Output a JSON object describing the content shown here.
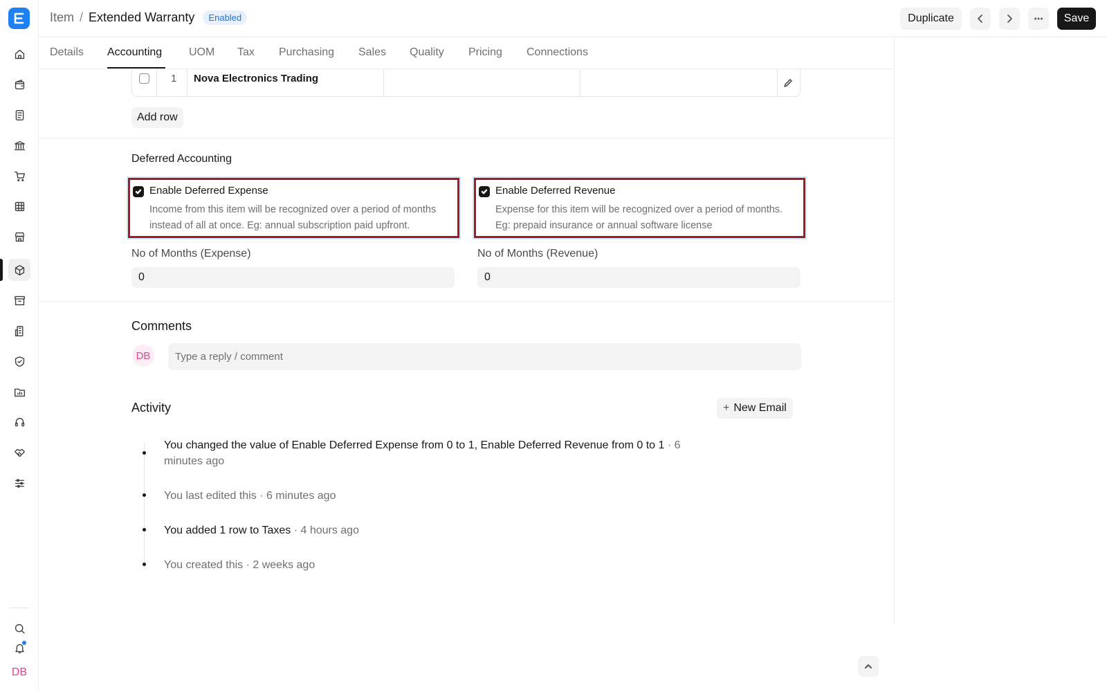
{
  "header": {
    "parent": "Item",
    "separator": "/",
    "title": "Extended Warranty",
    "status_badge": "Enabled",
    "duplicate_label": "Duplicate",
    "save_label": "Save"
  },
  "tabs": [
    "Details",
    "Accounting",
    "UOM",
    "Tax",
    "Purchasing",
    "Sales",
    "Quality",
    "Pricing",
    "Connections"
  ],
  "active_tab": "Accounting",
  "table": {
    "row": {
      "index": "1",
      "name": "Nova Electronics Trading"
    },
    "add_row_label": "Add row"
  },
  "deferred": {
    "section_title": "Deferred Accounting",
    "expense": {
      "label": "Enable Deferred Expense",
      "checked": true,
      "desc_line1": "Income from this item will be recognized over a period of months",
      "desc_line2": "instead of all at once. Eg: annual subscription paid upfront."
    },
    "revenue": {
      "label": "Enable Deferred Revenue",
      "checked": true,
      "desc_line1": "Expense for this item will be recognized over a period of months.",
      "desc_line2": "Eg: prepaid insurance or annual software license"
    },
    "months_expense": {
      "label": "No of Months (Expense)",
      "value": "0"
    },
    "months_revenue": {
      "label": "No of Months (Revenue)",
      "value": "0"
    }
  },
  "comments": {
    "title": "Comments",
    "avatar_initials": "DB",
    "placeholder": "Type a reply / comment"
  },
  "activity": {
    "title": "Activity",
    "new_email_label": "New Email",
    "items": [
      {
        "text_line1": "You changed the value of Enable Deferred Expense from 0 to 1, Enable Deferred Revenue from 0 to 1",
        "time_line1": " · 6",
        "time_line2": "minutes ago"
      },
      {
        "text": "You last edited this",
        "time": " · 6 minutes ago"
      },
      {
        "text": "You added 1 row to Taxes",
        "time": " · 4 hours ago"
      },
      {
        "text": "You created this",
        "time": " · 2 weeks ago"
      }
    ]
  },
  "sidebar": {
    "icons": [
      "home-icon",
      "wallet-icon",
      "document-icon",
      "bank-icon",
      "cart-icon",
      "table-icon",
      "store-icon",
      "box-icon",
      "archive-icon",
      "building-icon",
      "shield-icon",
      "folder-chart-icon",
      "headset-icon",
      "handshake-icon",
      "sliders-icon"
    ],
    "active_icon": "box-icon",
    "user_initials": "DB"
  },
  "colors": {
    "brand": "#1f80f4",
    "highlight_border": "#9e1c24",
    "avatar_pink": "#e0468e"
  }
}
